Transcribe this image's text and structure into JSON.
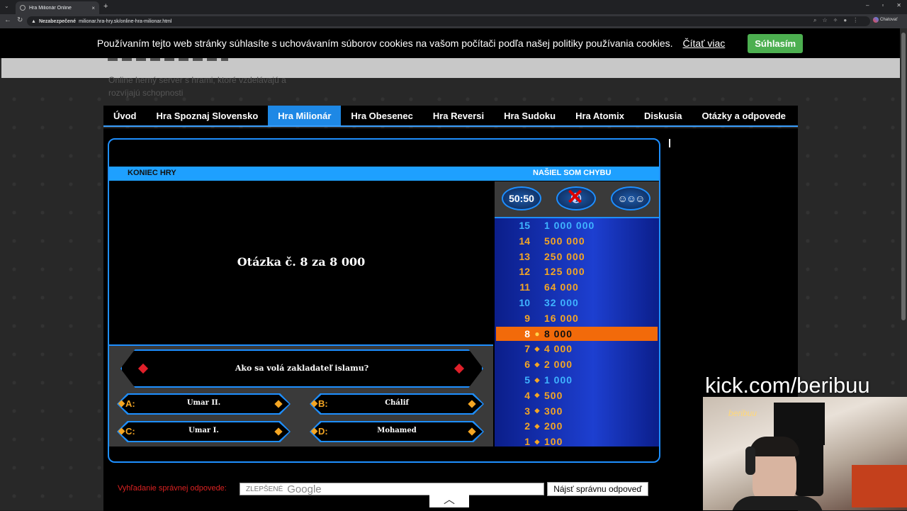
{
  "browser": {
    "tab_title": "Hra Milionár Online",
    "tab_close": "×",
    "new_tab": "+",
    "security_label": "Nezabezpečené",
    "url": "milionar.hra-hry.sk/online-hra-milionar.html",
    "chat_label": "Chatovať"
  },
  "cookie_banner": {
    "text": "Používaním tejto web stránky súhlasíte s uchovávaním súborov cookies na vašom počítači podľa našej politiky používania cookies.",
    "more_link": "Čítať viac",
    "accept_button": "Súhlasím"
  },
  "site": {
    "tagline": "Online herný server s hrami, ktoré vzdelávajú a rozvíjajú schopnosti"
  },
  "nav": {
    "items": [
      {
        "label": "Úvod"
      },
      {
        "label": "Hra Spoznaj Slovensko"
      },
      {
        "label": "Hra Milionár"
      },
      {
        "label": "Hra Obesenec"
      },
      {
        "label": "Hra Reversi"
      },
      {
        "label": "Hra Sudoku"
      },
      {
        "label": "Hra Atomix"
      },
      {
        "label": "Diskusia"
      },
      {
        "label": "Otázky a odpovede"
      }
    ],
    "active_index": 2
  },
  "game": {
    "end_game": "KONIEC HRY",
    "report_bug": "NAŠIEL SOM CHYBU",
    "question_number": "Otázka č. 8 za 8 000",
    "question": "Ako sa volá zakladateľ islamu?",
    "answers": [
      {
        "letter": "A:",
        "text": "Umar II."
      },
      {
        "letter": "B:",
        "text": "Chálif"
      },
      {
        "letter": "C:",
        "text": "Umar I."
      },
      {
        "letter": "D:",
        "text": "Mohamed"
      }
    ],
    "lifelines": {
      "fifty_fifty": "50:50",
      "phone_used": true,
      "audience": "audience-icon"
    },
    "ladder": [
      {
        "level": "15",
        "amount": "1 000 000",
        "milestone": true
      },
      {
        "level": "14",
        "amount": "500 000",
        "milestone": false
      },
      {
        "level": "13",
        "amount": "250 000",
        "milestone": false
      },
      {
        "level": "12",
        "amount": "125 000",
        "milestone": false
      },
      {
        "level": "11",
        "amount": "64 000",
        "milestone": false
      },
      {
        "level": "10",
        "amount": "32 000",
        "milestone": true
      },
      {
        "level": "9",
        "amount": "16 000",
        "milestone": false
      },
      {
        "level": "8",
        "amount": "8 000",
        "milestone": false
      },
      {
        "level": "7",
        "amount": "4 000",
        "milestone": false
      },
      {
        "level": "6",
        "amount": "2 000",
        "milestone": false
      },
      {
        "level": "5",
        "amount": "1 000",
        "milestone": true
      },
      {
        "level": "4",
        "amount": "500",
        "milestone": false
      },
      {
        "level": "3",
        "amount": "300",
        "milestone": false
      },
      {
        "level": "2",
        "amount": "200",
        "milestone": false
      },
      {
        "level": "1",
        "amount": "100",
        "milestone": false
      }
    ],
    "current_level": "8"
  },
  "search": {
    "label": "Vyhľadanie správnej odpovede:",
    "placeholder": "ZLEPŠENÉ",
    "google": "Google",
    "button": "Nájsť správnu odpoveď"
  },
  "overlay": {
    "stream_url": "kick.com/beribuu",
    "neon_sign": "beribuu"
  },
  "colors": {
    "accent_blue": "#1e8fff",
    "current_level": "#f26a0a",
    "milestone": "#ffffff",
    "regular_level": "#f5a623",
    "answer_letter": "#f5a623",
    "accept_green": "#4caf50"
  }
}
